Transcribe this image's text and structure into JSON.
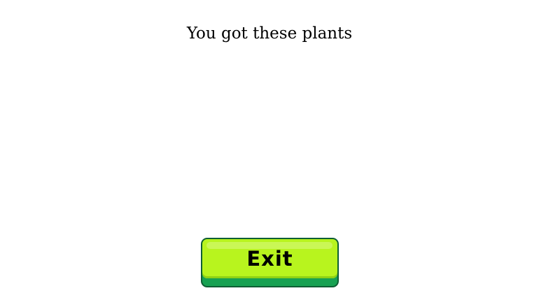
{
  "title": "You got these plants",
  "plants": [],
  "exit_button": {
    "label": "Exit"
  },
  "colors": {
    "button_face": "#b8f41e",
    "button_border": "#0e5e34",
    "button_base": "#17a152",
    "background": "#ffffff"
  }
}
